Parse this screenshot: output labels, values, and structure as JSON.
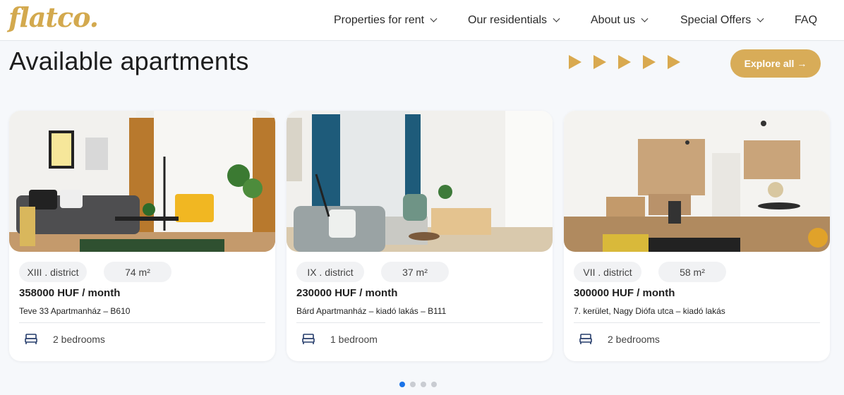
{
  "brand": {
    "logo_text": "flatco."
  },
  "nav": {
    "items": [
      {
        "label": "Properties for rent",
        "has_dropdown": true
      },
      {
        "label": "Our residentials",
        "has_dropdown": true
      },
      {
        "label": "About us",
        "has_dropdown": true
      },
      {
        "label": "Special Offers",
        "has_dropdown": true
      },
      {
        "label": "FAQ",
        "has_dropdown": false
      }
    ]
  },
  "section": {
    "title": "Available apartments",
    "explore_label": "Explore all →"
  },
  "listings": [
    {
      "district": "XIII . district",
      "area": "74 m²",
      "price": "358000 HUF / month",
      "address": "Teve 33 Apartmanház – B610",
      "bedrooms": "2 bedrooms"
    },
    {
      "district": "IX . district",
      "area": "37 m²",
      "price": "230000 HUF / month",
      "address": "Bárd Apartmanház – kiadó lakás – B111",
      "bedrooms": "1 bedroom"
    },
    {
      "district": "VII . district",
      "area": "58 m²",
      "price": "300000 HUF / month",
      "address": "7. kerület, Nagy Diófa utca – kiadó lakás",
      "bedrooms": "2 bedrooms"
    }
  ],
  "carousel": {
    "pages": 4,
    "active_index": 0
  },
  "colors": {
    "accent": "#d8ac58",
    "active_dot": "#1a73e8"
  }
}
